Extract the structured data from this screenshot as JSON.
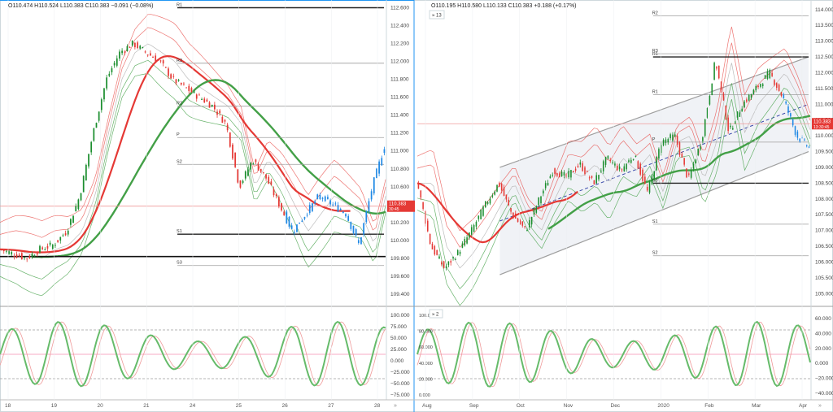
{
  "panels": [
    {
      "id": "left",
      "ohlc": "O110.474  H110.524  L110.383  C110.383  −0.091  (−0.08%)",
      "price_ticks": [
        "112.600",
        "112.400",
        "112.200",
        "112.000",
        "111.800",
        "111.600",
        "111.400",
        "111.200",
        "111.000",
        "110.800",
        "110.600",
        "110.400",
        "110.200",
        "110.000",
        "109.800",
        "109.600",
        "109.400"
      ],
      "price_tags": [
        "110.383",
        "30:45"
      ],
      "pivot_labels": [
        "R1",
        "R2",
        "R3",
        "P",
        "S1",
        "S2",
        "S3"
      ],
      "osc_ticks": [
        "100.000",
        "75.000",
        "50.000",
        "25.000",
        "0.000",
        "−25.000",
        "−50.000",
        "−75.000"
      ],
      "time_ticks": [
        "18",
        "19",
        "20",
        "21",
        "24",
        "25",
        "26",
        "27",
        "28"
      ],
      "scroll_label": "»"
    },
    {
      "id": "right",
      "ohlc": "O110.195  H110.580  L110.133  C110.383  +0.188  (+0.17%)",
      "study_label": "13",
      "osc_study_label": "2",
      "price_ticks": [
        "114.000",
        "113.500",
        "113.000",
        "112.500",
        "112.000",
        "111.500",
        "111.000",
        "110.500",
        "110.000",
        "109.500",
        "109.000",
        "108.500",
        "108.000",
        "107.500",
        "107.000",
        "106.500",
        "106.000",
        "105.500",
        "105.000"
      ],
      "price_tags": [
        "110.383",
        "13:30:45"
      ],
      "pivot_labels": [
        "R2",
        "R1",
        "R1",
        "P",
        "S1",
        "S2",
        "S3",
        "R3"
      ],
      "osc_ticks_left": [
        "100.000",
        "80.000",
        "60.000",
        "40.000",
        "20.000",
        "0.000"
      ],
      "osc_ticks_right": [
        "60.000",
        "40.000",
        "20.000",
        "0.000",
        "−20.000",
        "−40.000"
      ],
      "time_ticks": [
        "Aug",
        "Sep",
        "Oct",
        "Nov",
        "Dec",
        "2020",
        "Feb",
        "Mar",
        "Apr"
      ],
      "scroll_label": "»"
    }
  ],
  "chart_data": [
    {
      "type": "candlestick",
      "symbol": "",
      "panel": "left",
      "ylim": [
        109.3,
        112.65
      ],
      "x_ticks": [
        "18",
        "19",
        "20",
        "21",
        "24",
        "25",
        "26",
        "27",
        "28"
      ],
      "close_path": [
        109.9,
        109.85,
        109.8,
        109.9,
        109.95,
        110.1,
        110.5,
        111.2,
        111.8,
        112.1,
        112.2,
        112.1,
        112.0,
        111.8,
        111.7,
        111.6,
        111.5,
        111.3,
        110.6,
        110.9,
        110.7,
        110.4,
        110.1,
        110.3,
        110.5,
        110.4,
        110.3,
        109.95,
        110.6,
        111.1
      ],
      "pivots": {
        "R1": 112.6,
        "R2": 111.5,
        "R3": 111.98,
        "P": 111.15,
        "S1": 110.07,
        "S2": 110.85,
        "S3": 109.72
      },
      "colors": {
        "up": "#1b8e2e",
        "down": "#e53935",
        "projection": "#1e88e5",
        "ma_red": "#e53935",
        "ma_green": "#43a047"
      },
      "last_price": 110.383
    },
    {
      "type": "candlestick",
      "symbol": "",
      "panel": "right",
      "ylim": [
        104.7,
        114.2
      ],
      "x_ticks": [
        "Aug",
        "Sep",
        "Oct",
        "Nov",
        "Dec",
        "2020",
        "Feb",
        "Mar",
        "Apr"
      ],
      "close_path": [
        108.5,
        106.5,
        105.8,
        106.3,
        107.0,
        107.8,
        108.5,
        107.5,
        107.0,
        108.0,
        108.9,
        108.7,
        109.1,
        108.5,
        109.3,
        108.9,
        109.4,
        108.2,
        109.8,
        110.0,
        108.6,
        109.9,
        112.4,
        110.1,
        111.0,
        111.5,
        112.0,
        111.2,
        110.0,
        109.6
      ],
      "pivots": {
        "R2": 113.8,
        "R1": 112.5,
        "R1b": 111.3,
        "P": 109.8,
        "S1": 107.2,
        "S2": 106.2,
        "S3": 108.5,
        "R3": 112.6
      },
      "channel": {
        "upper": [
          109.0,
          112.5
        ],
        "lower": [
          105.6,
          109.5
        ]
      },
      "colors": {
        "up": "#1b8e2e",
        "down": "#e53935",
        "projection": "#1e88e5",
        "ma_red": "#e53935",
        "ma_green": "#43a047"
      },
      "last_price": 110.383
    }
  ]
}
